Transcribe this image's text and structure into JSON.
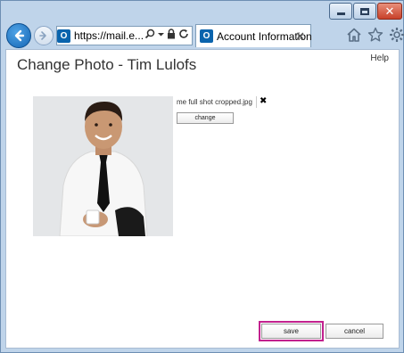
{
  "browser": {
    "address_url": "https://mail.e...",
    "tab_title": "Account Information",
    "outlook_icon_letter": "O"
  },
  "page": {
    "title": "Change Photo - Tim Lulofs",
    "help_label": "Help"
  },
  "photo": {
    "file_name": "me full shot cropped.jpg",
    "change_label": "change"
  },
  "actions": {
    "save_label": "save",
    "cancel_label": "cancel"
  },
  "colors": {
    "highlight": "#c2218e",
    "ie_blue": "#1566b5",
    "outlook_blue": "#0a64ad"
  }
}
